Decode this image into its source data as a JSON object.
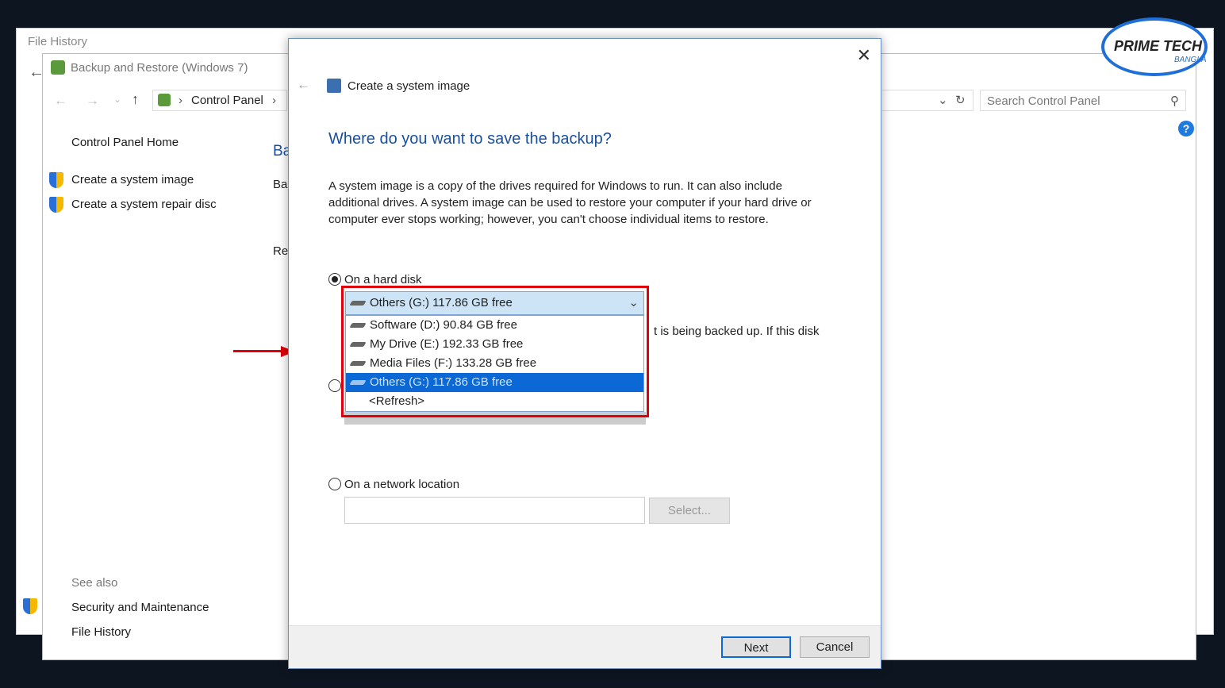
{
  "background_window": {
    "title": "File History"
  },
  "main_window": {
    "title": "Backup and Restore (Windows 7)",
    "breadcrumb": [
      "Control Panel"
    ],
    "search_placeholder": "Search Control Panel",
    "sidebar": {
      "home": "Control Panel Home",
      "items": [
        "Create a system image",
        "Create a system repair disc"
      ],
      "see_also": "See also",
      "see_also_items": [
        "Security and Maintenance",
        "File History"
      ]
    },
    "content_fragments": [
      "Ba",
      "Ba",
      "Re"
    ]
  },
  "dialog": {
    "title": "Create a system image",
    "heading": "Where do you want to save the backup?",
    "description": "A system image is a copy of the drives required for Windows to run. It can also include additional drives. A system image can be used to restore your computer if your hard drive or computer ever stops working; however, you can't choose individual items to restore.",
    "hard_disk_label": "On a hard disk",
    "selected_drive": "Others (G:)  117.86 GB free",
    "drive_options": [
      "Software (D:)  90.84 GB free",
      "My Drive (E:)  192.33 GB free",
      "Media Files (F:)  133.28 GB free",
      "Others (G:)  117.86 GB free",
      "<Refresh>"
    ],
    "partial_text": "t is being backed up. If this disk",
    "network_label": "On a network location",
    "select_button": "Select...",
    "next_button": "Next",
    "cancel_button": "Cancel"
  },
  "logo": {
    "text": "PRIME TECH",
    "sub": "BANGLA"
  },
  "colors": {
    "heading": "#1a4f9c",
    "highlight": "#e0000b",
    "selection": "#0c68d4"
  }
}
